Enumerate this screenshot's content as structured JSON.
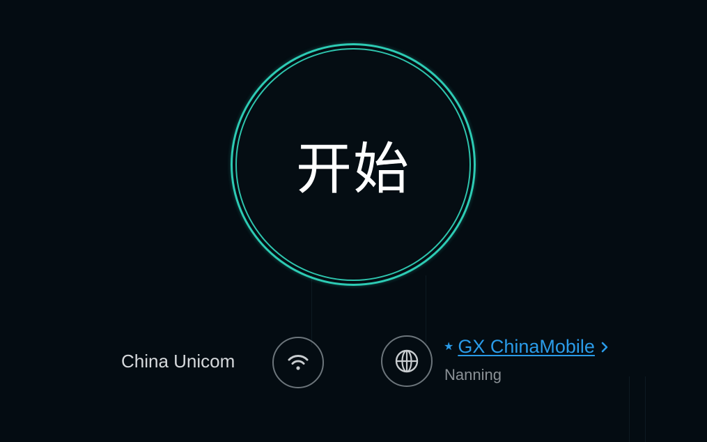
{
  "go_button": {
    "label": "开始"
  },
  "connection": {
    "isp_name": "China Unicom",
    "isp_icon": "wifi-icon",
    "server_icon": "globe-icon",
    "server_name": "GX ChinaMobile",
    "server_location": "Nanning",
    "server_marker_icon": "star-icon",
    "server_change_icon": "chevron-right-icon"
  },
  "colors": {
    "background": "#040c12",
    "ring_accent": "#2dcbb4",
    "link_blue": "#2a9be8",
    "text_primary": "#ffffff",
    "text_secondary": "#8b9196"
  }
}
